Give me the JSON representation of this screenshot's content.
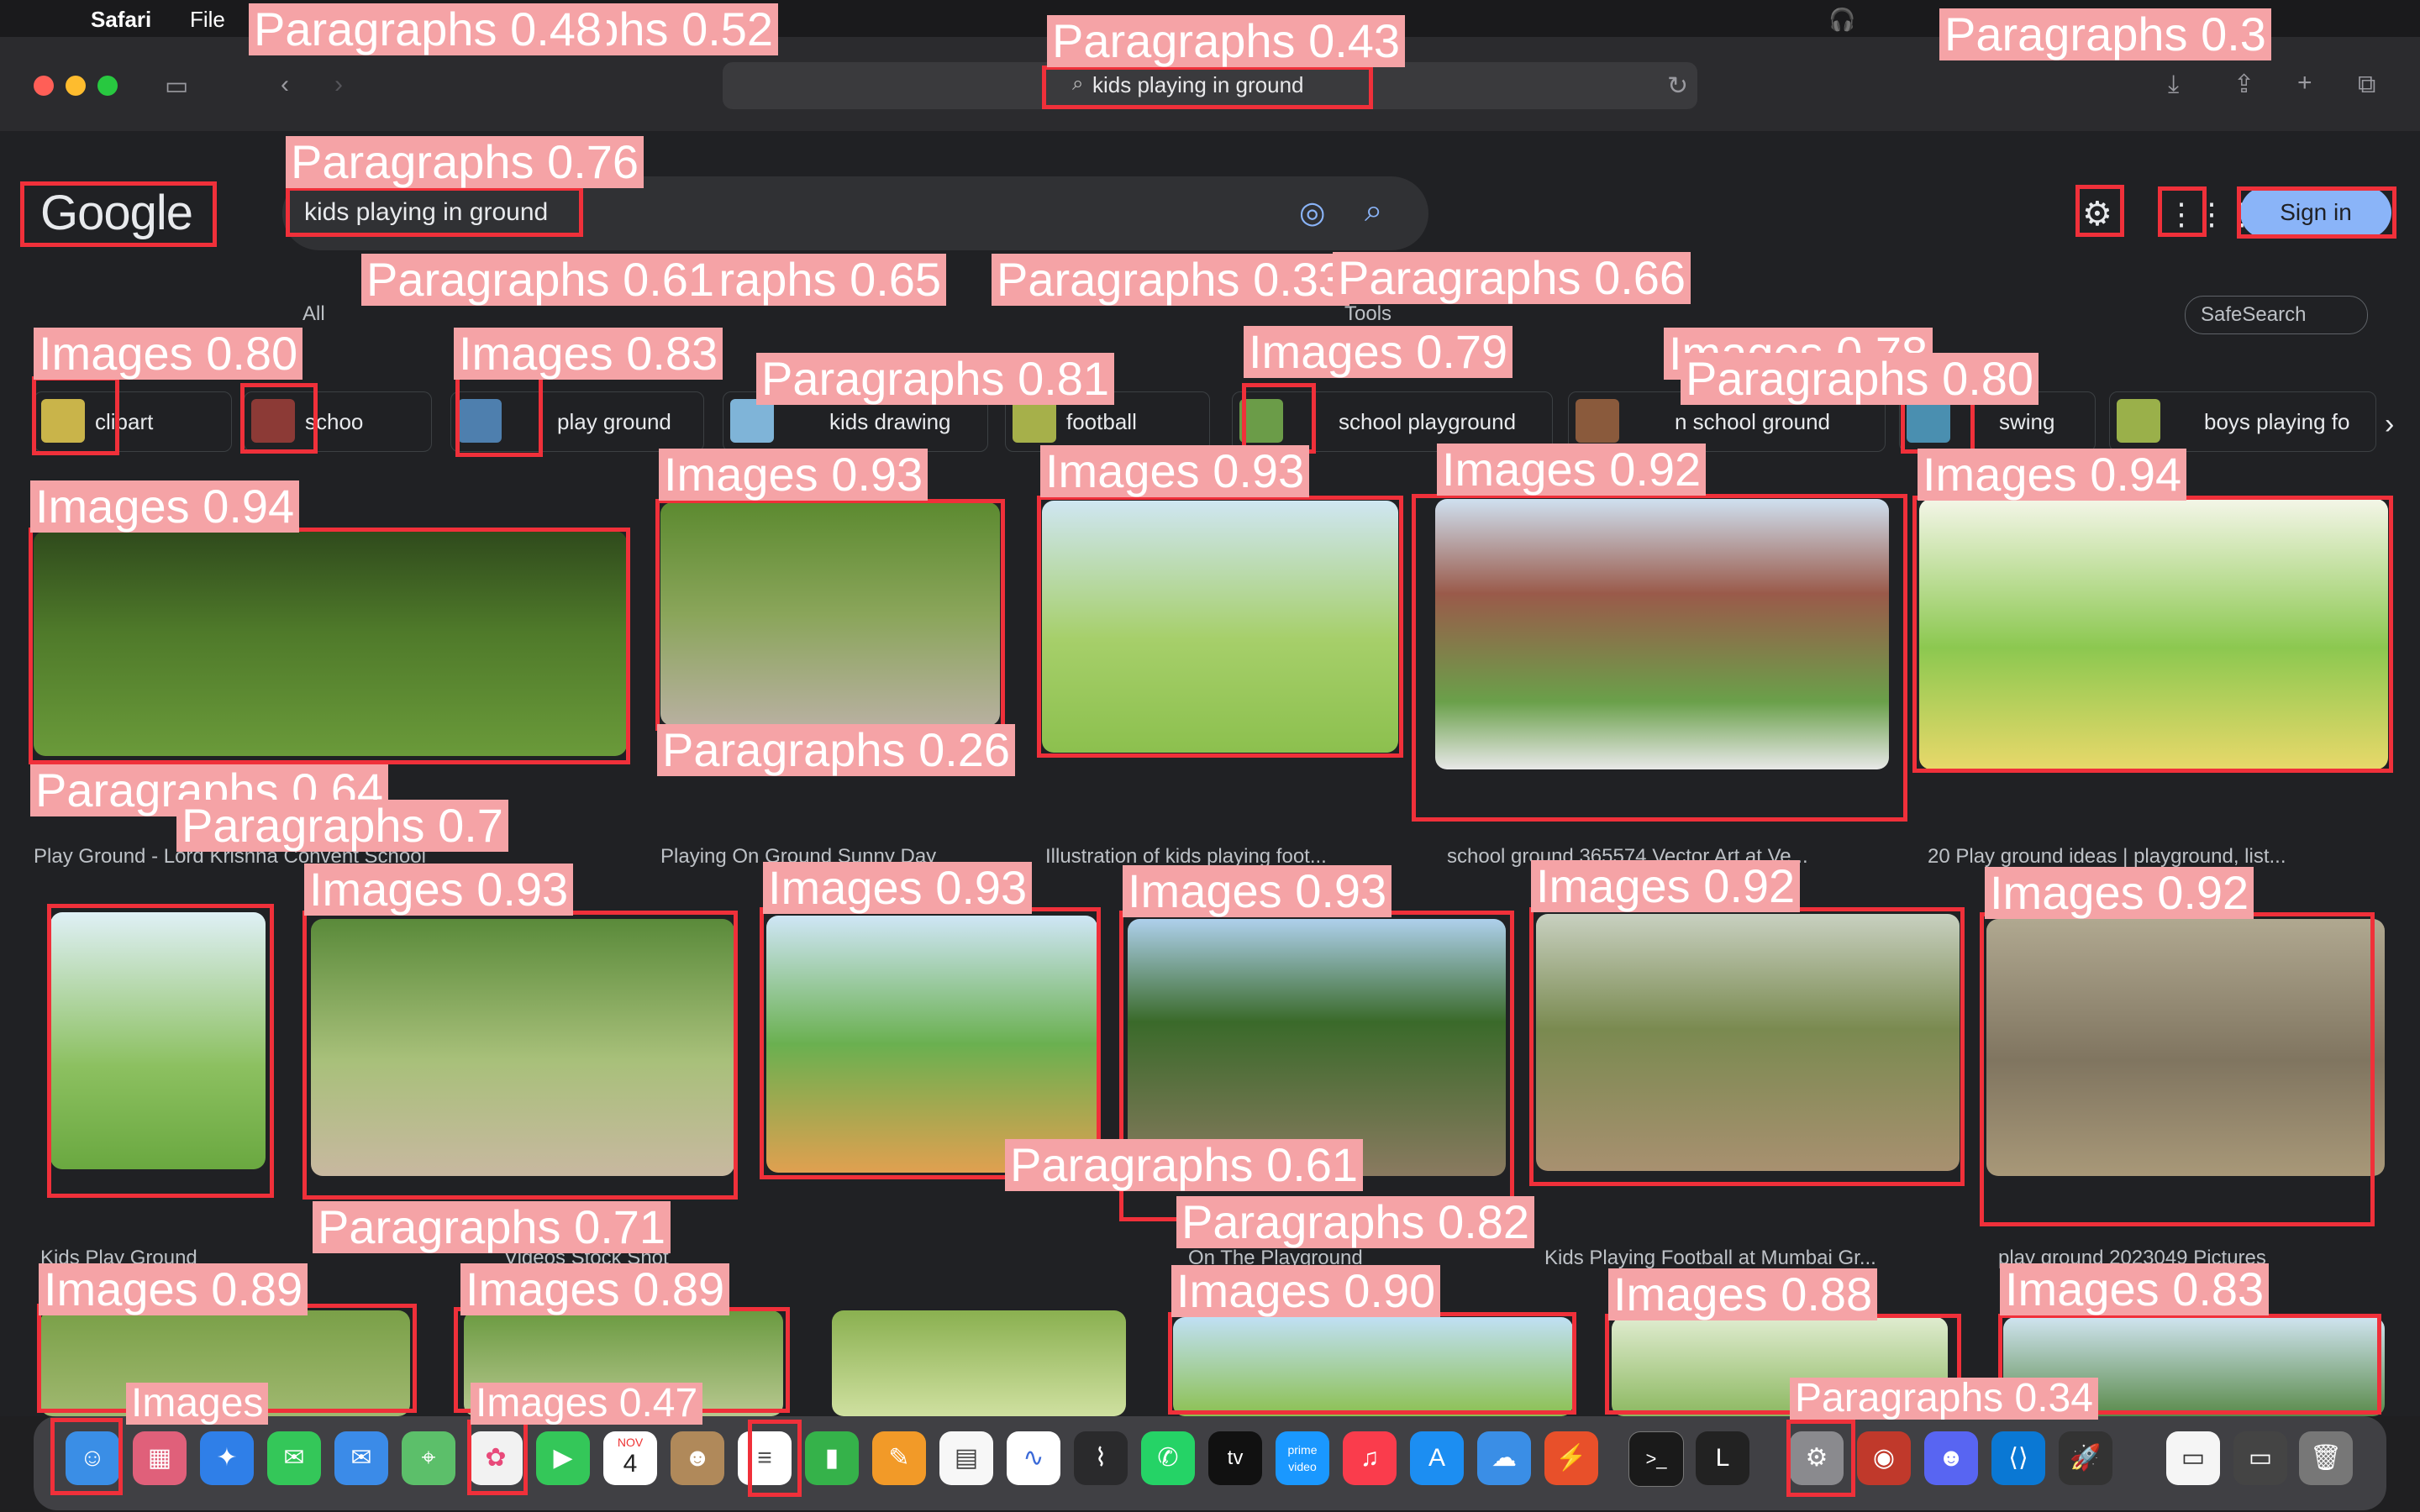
{
  "menubar": {
    "app": "Safari",
    "file": "File"
  },
  "address_bar": {
    "url": "kids playing in ground"
  },
  "google": {
    "logo": "Google",
    "query": "kids playing in ground",
    "signin": "Sign in",
    "tab_all": "All",
    "tools": "Tools",
    "safesearch": "SafeSearch"
  },
  "chips": [
    {
      "label": "clipart"
    },
    {
      "label": "schoo"
    },
    {
      "label": "play ground"
    },
    {
      "label": "kids drawing"
    },
    {
      "label": "football"
    },
    {
      "label": "school playground"
    },
    {
      "label": "n school ground"
    },
    {
      "label": "swing"
    },
    {
      "label": "boys playing fo"
    }
  ],
  "captions": [
    "Play Ground - Lord Krishna Convent School",
    "Playing On Ground Sunny Day",
    "Illustration of kids playing foot...",
    "school ground 365574 Vector Art at Ve...",
    "20 Play ground ideas | playground, list...",
    "Kids Play Ground",
    "Videos Stock Shot",
    "On The Playground",
    "Kids Playing Football at Mumbai Gr...",
    "play ground 2023049 Pictures"
  ],
  "dock": {
    "calendar_month": "NOV",
    "calendar_day": "4",
    "tv": "tv",
    "prime": "prime video",
    "l_app": "L"
  },
  "detections": [
    {
      "label": "Paragraphs 0.52"
    },
    {
      "label": "Paragraphs 0.48"
    },
    {
      "label": "Paragraphs 0.43"
    },
    {
      "label": "Paragraphs 0.3"
    },
    {
      "label": "Paragraphs 0.76"
    },
    {
      "label": "Paragraphs 0.65"
    },
    {
      "label": "Paragraphs 0.61"
    },
    {
      "label": "Paragraphs 0.33"
    },
    {
      "label": "Paragraphs 0.66"
    },
    {
      "label": "Images 0.80"
    },
    {
      "label": "Images 0.83"
    },
    {
      "label": "Paragraphs 0.81"
    },
    {
      "label": "Images 0.79"
    },
    {
      "label": "Images 0.78"
    },
    {
      "label": "Paragraphs 0.80"
    },
    {
      "label": "Images 0.94"
    },
    {
      "label": "Images 0.93"
    },
    {
      "label": "Images 0.93"
    },
    {
      "label": "Images 0.92"
    },
    {
      "label": "Images 0.94"
    },
    {
      "label": "Paragraphs 0.26"
    },
    {
      "label": "Paragraphs 0.64"
    },
    {
      "label": "Paragraphs 0.7"
    },
    {
      "label": "Images 0.93"
    },
    {
      "label": "Images 0.93"
    },
    {
      "label": "Images 0.93"
    },
    {
      "label": "Images 0.92"
    },
    {
      "label": "Images 0.92"
    },
    {
      "label": "Paragraphs 0.61"
    },
    {
      "label": "Paragraphs 0.71"
    },
    {
      "label": "Paragraphs 0.82"
    },
    {
      "label": "Images 0.89"
    },
    {
      "label": "Images 0.89"
    },
    {
      "label": "Images 0.90"
    },
    {
      "label": "Images 0.88"
    },
    {
      "label": "Images 0.83"
    },
    {
      "label": "Images 0.47"
    },
    {
      "label": "Paragraphs 0.34"
    },
    {
      "label": "Images"
    }
  ]
}
